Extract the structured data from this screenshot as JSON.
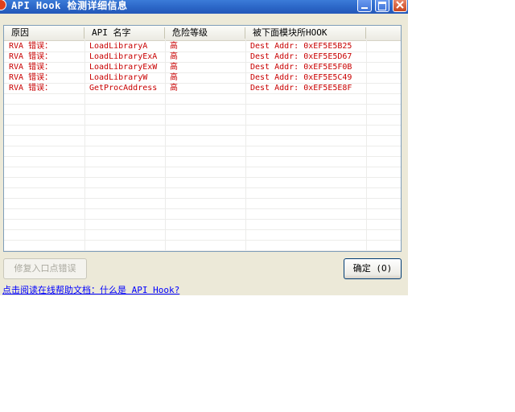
{
  "window": {
    "title": "API Hook 检测详细信息"
  },
  "list": {
    "columns": [
      "原因",
      "API 名字",
      "危险等级",
      "被下面模块所HOOK"
    ],
    "rows": [
      [
        "RVA 错误：",
        "LoadLibraryA",
        "高",
        "Dest Addr: 0xEF5E5B25"
      ],
      [
        "RVA 错误：",
        "LoadLibraryExA",
        "高",
        "Dest Addr: 0xEF5E5D67"
      ],
      [
        "RVA 错误：",
        "LoadLibraryExW",
        "高",
        "Dest Addr: 0xEF5E5F0B"
      ],
      [
        "RVA 错误：",
        "LoadLibraryW",
        "高",
        "Dest Addr: 0xEF5E5C49"
      ],
      [
        "RVA 错误：",
        "GetProcAddress",
        "高",
        "Dest Addr: 0xEF5E5E8F"
      ]
    ],
    "text_color": "#c80000"
  },
  "buttons": {
    "fix_label": "修复入口点错误",
    "ok_label": "确定 (O)"
  },
  "help_link": "点击阅读在线帮助文档：什么是 API Hook?"
}
